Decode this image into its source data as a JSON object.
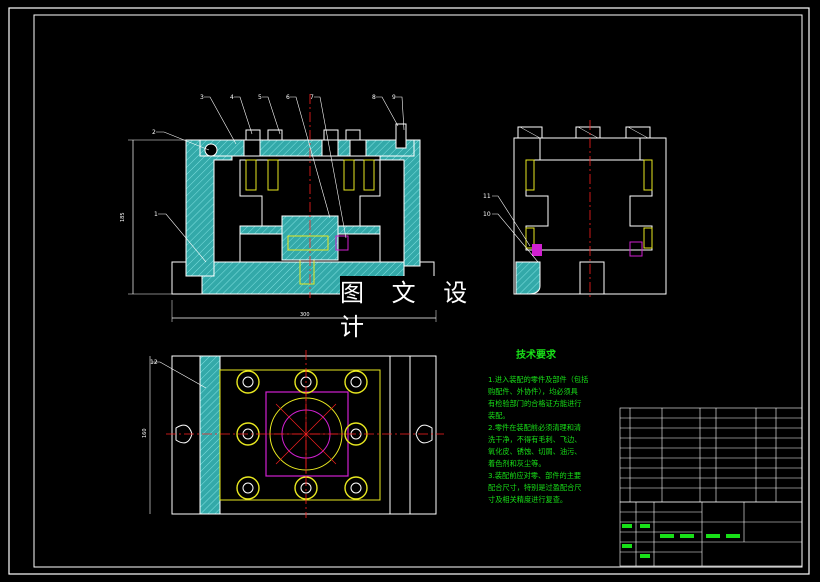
{
  "watermark": "图 文 设 计",
  "tech_requirements": {
    "title": "技术要求",
    "lines": [
      "1.进入装配的零件及部件（包括",
      "购配件、外协件），均必须具",
      "有检验部门的合格证方能进行",
      "装配。",
      "2.零件在装配前必须清理和清",
      "洗干净，不得有毛刺、飞边、",
      "氧化皮、锈蚀、切屑、油污、",
      "着色剂和灰尘等。",
      "3.装配前应对零、部件的主要",
      "配合尺寸，特别是过盈配合尺",
      "寸及相关精度进行复查。"
    ]
  },
  "balloons_front": [
    "1",
    "2",
    "3",
    "4",
    "5",
    "6",
    "7",
    "8",
    "9"
  ],
  "balloons_side": [
    "10",
    "11"
  ],
  "balloons_top": [
    "12"
  ],
  "dim_labels": {
    "height": "185",
    "width": "300",
    "top_height": "160"
  },
  "colors": {
    "background": "#000000",
    "hatch": "#3fb6b6",
    "line": "#ffffff",
    "accent": "#ff2020",
    "green": "#18e018",
    "yellow": "#e8e820",
    "magenta": "#d020d0"
  }
}
